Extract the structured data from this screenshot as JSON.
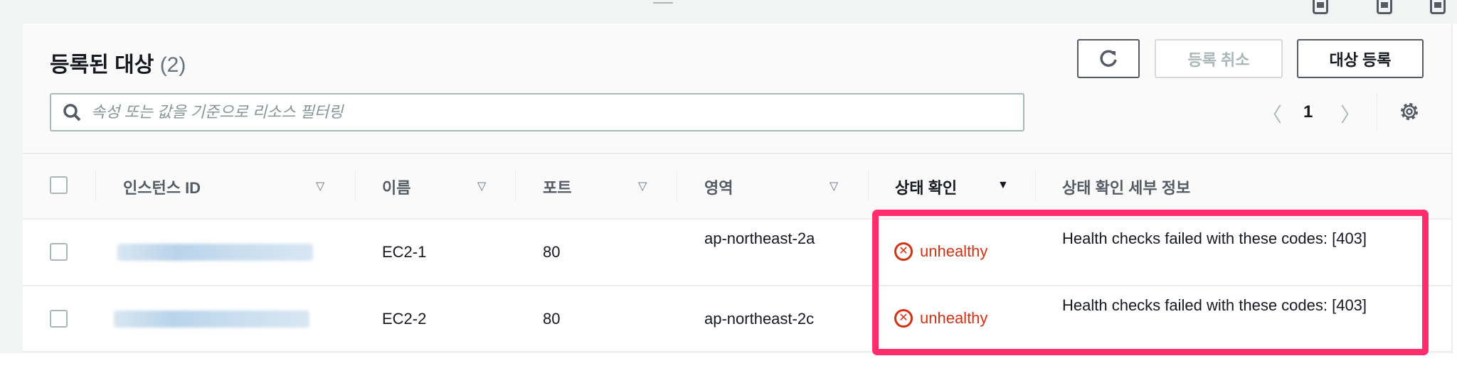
{
  "panel": {
    "title": "등록된 대상",
    "count": "(2)"
  },
  "toolbar": {
    "refresh_icon": "refresh-icon",
    "deregister_label": "등록 취소",
    "register_label": "대상 등록"
  },
  "search": {
    "placeholder": "속성 또는 값을 기준으로 리소스 필터링"
  },
  "pagination": {
    "page": "1"
  },
  "table": {
    "headers": [
      "인스턴스 ID",
      "이름",
      "포트",
      "영역",
      "상태 확인",
      "상태 확인 세부 정보"
    ],
    "rows": [
      {
        "name": "EC2-1",
        "port": "80",
        "zone": "ap-northeast-2a",
        "health": "unhealthy",
        "details": "Health checks failed with these codes: [403]"
      },
      {
        "name": "EC2-2",
        "port": "80",
        "zone": "ap-northeast-2c",
        "health": "unhealthy",
        "details": "Health checks failed with these codes: [403]"
      }
    ]
  },
  "colors": {
    "highlight": "#ff2d6b",
    "error": "#d13212"
  }
}
